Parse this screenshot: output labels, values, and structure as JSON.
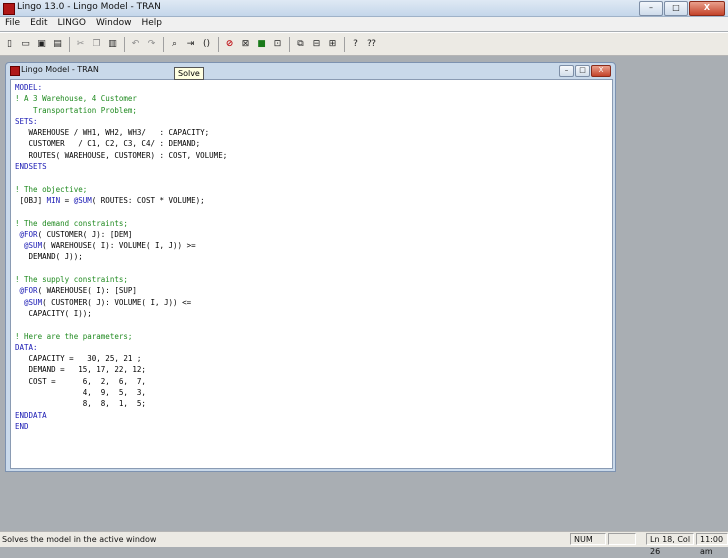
{
  "app": {
    "title": "Lingo 13.0 - Lingo Model - TRAN",
    "controls": {
      "minimize": "–",
      "maximize": "□",
      "close": "X"
    }
  },
  "menu": [
    "File",
    "Edit",
    "LINGO",
    "Window",
    "Help"
  ],
  "toolbar": {
    "buttons": [
      {
        "name": "new-icon",
        "glyph": "▯",
        "style": ""
      },
      {
        "name": "open-icon",
        "glyph": "▭",
        "style": ""
      },
      {
        "name": "save-icon",
        "glyph": "▣",
        "style": ""
      },
      {
        "name": "print-icon",
        "glyph": "▤",
        "style": ""
      },
      {
        "sep": true
      },
      {
        "name": "cut-icon",
        "glyph": "✂",
        "style": "gray"
      },
      {
        "name": "copy-icon",
        "glyph": "❐",
        "style": "gray"
      },
      {
        "name": "paste-icon",
        "glyph": "▥",
        "style": ""
      },
      {
        "sep": true
      },
      {
        "name": "undo-icon",
        "glyph": "↶",
        "style": "gray"
      },
      {
        "name": "redo-icon",
        "glyph": "↷",
        "style": "gray"
      },
      {
        "sep": true
      },
      {
        "name": "find-icon",
        "glyph": "⌕",
        "style": ""
      },
      {
        "name": "goto-line-icon",
        "glyph": "⇥",
        "style": ""
      },
      {
        "name": "match-paren-icon",
        "glyph": "()",
        "style": ""
      },
      {
        "sep": true
      },
      {
        "name": "solve-icon",
        "glyph": "⊘",
        "style": "red"
      },
      {
        "name": "solution-icon",
        "glyph": "⊠",
        "style": ""
      },
      {
        "name": "matrix-picture-icon",
        "glyph": "■",
        "style": "green"
      },
      {
        "name": "options-icon",
        "glyph": "⊡",
        "style": ""
      },
      {
        "sep": true
      },
      {
        "name": "send-to-back-icon",
        "glyph": "⧉",
        "style": ""
      },
      {
        "name": "close-all-icon",
        "glyph": "⊟",
        "style": ""
      },
      {
        "name": "tile-icon",
        "glyph": "⊞",
        "style": ""
      },
      {
        "sep": true
      },
      {
        "name": "help-icon",
        "glyph": "?",
        "style": ""
      },
      {
        "name": "context-help-icon",
        "glyph": "⁇",
        "style": ""
      }
    ]
  },
  "tooltip": "Solve",
  "document": {
    "title": "Lingo Model - TRAN",
    "controls": {
      "minimize": "–",
      "maximize": "□",
      "close": "X"
    },
    "lines": [
      [
        [
          "c-blue",
          "MODEL:"
        ]
      ],
      [
        [
          "c-green",
          "! A 3 Warehouse, 4 Customer"
        ]
      ],
      [
        [
          "c-green",
          "    Transportation Problem;"
        ]
      ],
      [
        [
          "c-blue",
          "SETS:"
        ]
      ],
      [
        [
          "c-black",
          "   WAREHOUSE / WH1, WH2, WH3/   : CAPACITY;"
        ]
      ],
      [
        [
          "c-black",
          "   CUSTOMER   / C1, C2, C3, C4/ : DEMAND;"
        ]
      ],
      [
        [
          "c-black",
          "   ROUTES( WAREHOUSE, CUSTOMER) : COST, VOLUME;"
        ]
      ],
      [
        [
          "c-blue",
          "ENDSETS"
        ]
      ],
      [
        [
          "c-black",
          ""
        ]
      ],
      [
        [
          "c-green",
          "! The objective;"
        ]
      ],
      [
        [
          "c-black",
          " [OBJ] "
        ],
        [
          "c-blue",
          "MIN"
        ],
        [
          "c-black",
          " = "
        ],
        [
          "c-blue",
          "@SUM"
        ],
        [
          "c-black",
          "( ROUTES: COST * VOLUME);"
        ]
      ],
      [
        [
          "c-black",
          ""
        ]
      ],
      [
        [
          "c-green",
          "! The demand constraints;"
        ]
      ],
      [
        [
          "c-black",
          " "
        ],
        [
          "c-blue",
          "@FOR"
        ],
        [
          "c-black",
          "( CUSTOMER( J): [DEM]"
        ]
      ],
      [
        [
          "c-black",
          "  "
        ],
        [
          "c-blue",
          "@SUM"
        ],
        [
          "c-black",
          "( WAREHOUSE( I): VOLUME( I, J)) >="
        ]
      ],
      [
        [
          "c-black",
          "   DEMAND( J));"
        ]
      ],
      [
        [
          "c-black",
          ""
        ]
      ],
      [
        [
          "c-green",
          "! The supply constraints;"
        ]
      ],
      [
        [
          "c-black",
          " "
        ],
        [
          "c-blue",
          "@FOR"
        ],
        [
          "c-black",
          "( WAREHOUSE( I): [SUP]"
        ]
      ],
      [
        [
          "c-black",
          "  "
        ],
        [
          "c-blue",
          "@SUM"
        ],
        [
          "c-black",
          "( CUSTOMER( J): VOLUME( I, J)) <="
        ]
      ],
      [
        [
          "c-black",
          "   CAPACITY( I));"
        ]
      ],
      [
        [
          "c-black",
          ""
        ]
      ],
      [
        [
          "c-green",
          "! Here are the parameters;"
        ]
      ],
      [
        [
          "c-blue",
          "DATA:"
        ]
      ],
      [
        [
          "c-black",
          "   CAPACITY =   30, 25, 21 ;"
        ]
      ],
      [
        [
          "c-black",
          "   DEMAND =   15, 17, 22, 12;"
        ]
      ],
      [
        [
          "c-black",
          "   COST =      6,  2,  6,  7,"
        ]
      ],
      [
        [
          "c-black",
          "               4,  9,  5,  3,"
        ]
      ],
      [
        [
          "c-black",
          "               8,  8,  1,  5;"
        ]
      ],
      [
        [
          "c-blue",
          "ENDDATA"
        ]
      ],
      [
        [
          "c-blue",
          "END"
        ]
      ]
    ]
  },
  "status": {
    "message": "Solves the model in the active window",
    "num": "NUM",
    "position": "Ln 18, Col 26",
    "time": "11:00 am"
  }
}
